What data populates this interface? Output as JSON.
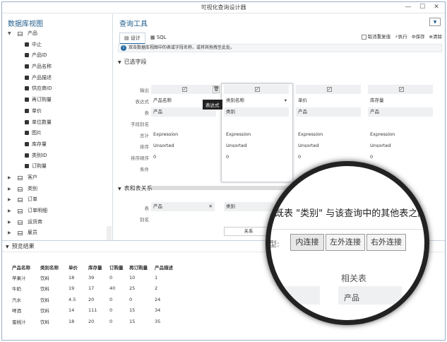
{
  "window": {
    "title": "可视化查询设计器",
    "buttons": [
      "—",
      "☐",
      "✕"
    ]
  },
  "left_panel": {
    "title": "数据库视图",
    "tree": [
      {
        "label": "产品",
        "kind": "table",
        "expanded": true,
        "level": 0
      },
      {
        "label": "中止",
        "kind": "field",
        "level": 1
      },
      {
        "label": "产品ID",
        "kind": "field",
        "level": 1
      },
      {
        "label": "产品名称",
        "kind": "field",
        "level": 1
      },
      {
        "label": "产品描述",
        "kind": "field",
        "level": 1
      },
      {
        "label": "供应商ID",
        "kind": "field",
        "level": 1
      },
      {
        "label": "再订购量",
        "kind": "field",
        "level": 1
      },
      {
        "label": "单价",
        "kind": "field",
        "level": 1
      },
      {
        "label": "单位数量",
        "kind": "field",
        "level": 1
      },
      {
        "label": "图片",
        "kind": "field",
        "level": 1
      },
      {
        "label": "库存量",
        "kind": "field",
        "level": 1
      },
      {
        "label": "类别ID",
        "kind": "field",
        "level": 1
      },
      {
        "label": "订购量",
        "kind": "field",
        "level": 1
      },
      {
        "label": "客户",
        "kind": "table",
        "expanded": false,
        "level": 0
      },
      {
        "label": "类别",
        "kind": "table",
        "expanded": false,
        "level": 0
      },
      {
        "label": "订单",
        "kind": "table",
        "expanded": false,
        "level": 0
      },
      {
        "label": "订单明细",
        "kind": "table",
        "expanded": false,
        "level": 0
      },
      {
        "label": "运货商",
        "kind": "table",
        "expanded": false,
        "level": 0
      },
      {
        "label": "雇员",
        "kind": "table",
        "expanded": false,
        "level": 0
      }
    ]
  },
  "query_tool": {
    "title": "查询工具",
    "tabs": [
      "设计",
      "SQL"
    ],
    "toolbar": {
      "distinct": "取消重复值",
      "execute": "执行",
      "save": "保存",
      "clear": "清除"
    },
    "info": "双击数据库视图中的表或字段名称，或将其拖拽至此处。",
    "fields_section": "已选字段",
    "row_labels": [
      "输出",
      "表达式",
      "表",
      "字段别名",
      "总计",
      "排序",
      "排序顺序",
      "条件"
    ],
    "columns": [
      {
        "output": "✓",
        "expression": "产品名称",
        "table": "产品",
        "alias": "",
        "total": "Expression",
        "sort": "Unsorted",
        "order": "0"
      },
      {
        "output": "✓",
        "expression": "类别名称",
        "table": "类别",
        "alias": "",
        "total": "Expression",
        "sort": "Unsorted",
        "order": "0"
      },
      {
        "output": "✓",
        "expression": "单价",
        "table": "产品",
        "alias": "",
        "total": "Expression",
        "sort": "Unsorted",
        "order": "0"
      },
      {
        "output": "✓",
        "expression": "库存量",
        "table": "产品",
        "alias": "",
        "total": "Expression",
        "sort": "Unsorted",
        "order": "0"
      }
    ],
    "tooltip": "表达式",
    "relations_section": "表和表关系",
    "relation_labels": [
      "表",
      "别名"
    ],
    "relation_table1": "产品",
    "relation_table2": "类别",
    "relation_button": "关系"
  },
  "magnifier": {
    "text": "既表 \"类别\" 与该查询中的其他表之间的",
    "join_label": "型:",
    "joins": [
      "内连接",
      "左外连接",
      "右外连接"
    ],
    "col1": "段",
    "col2": "相关表",
    "value": "产品"
  },
  "preview": {
    "title": "预览结果",
    "headers": [
      "产品名称",
      "类别名称",
      "单价",
      "库存量",
      "订购量",
      "再订购量",
      "产品描述"
    ],
    "rows": [
      [
        "苹果汁",
        "饮料",
        "18",
        "39",
        "0",
        "10",
        "1"
      ],
      [
        "牛奶",
        "饮料",
        "19",
        "17",
        "40",
        "25",
        "2"
      ],
      [
        "汽水",
        "饮料",
        "4.5",
        "20",
        "0",
        "0",
        "24"
      ],
      [
        "啤酒",
        "饮料",
        "14",
        "111",
        "0",
        "15",
        "34"
      ],
      [
        "蜜桃汁",
        "饮料",
        "18",
        "20",
        "0",
        "15",
        "35"
      ]
    ]
  }
}
